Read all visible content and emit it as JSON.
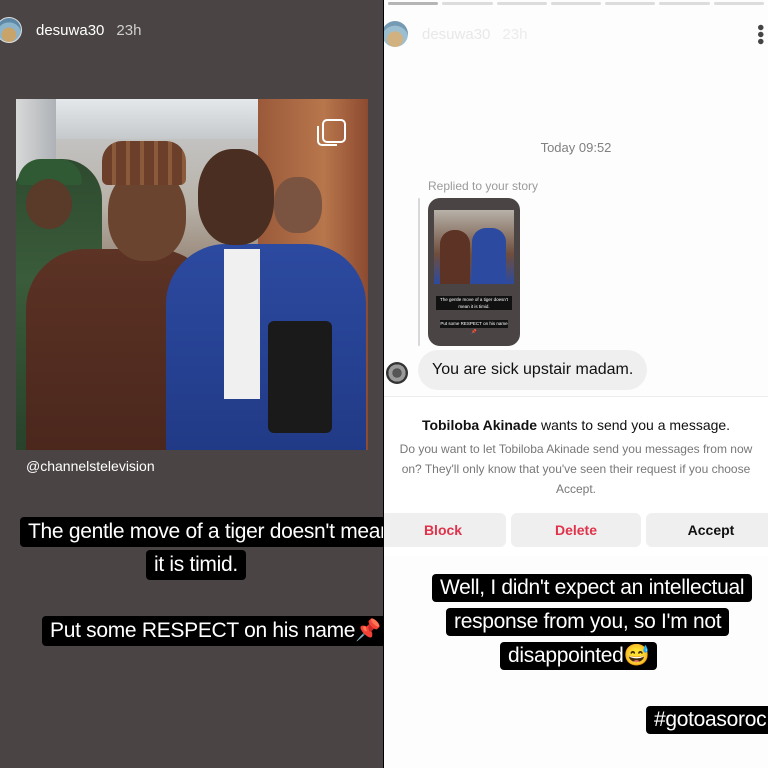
{
  "left_story": {
    "username": "desuwa30",
    "time": "23h",
    "photo_credit": "@channelstelevision",
    "caption_lines": [
      "The gentle move of a tiger doesn't mean",
      "it is timid.",
      "Put some RESPECT on his name📌"
    ]
  },
  "right_story": {
    "username": "desuwa30",
    "time": "23h",
    "chat": {
      "timestamp": "Today 09:52",
      "replied_label": "Replied to your story",
      "thumb_caption_1": "The gentle move of a tiger doesn't mean it is timid.",
      "thumb_caption_2": "Put some RESPECT on his name📌",
      "message": "You are sick upstair madam."
    },
    "request": {
      "sender": "Tobiloba Akinade",
      "title_rest": " wants to send you a message.",
      "subtitle": "Do you want to let Tobiloba Akinade send you messages from now on? They'll only know that you've seen their request if you choose Accept.",
      "block_label": "Block",
      "delete_label": "Delete",
      "accept_label": "Accept"
    },
    "caption_lines": [
      "Well, I didn't expect an intellectual",
      "response from you, so I'm not",
      "disappointed😅"
    ],
    "hashtag": "#gotoasoroc"
  },
  "colors": {
    "left_bg": "#4a4444",
    "caption_bg": "#000000",
    "destructive": "#e0334b"
  }
}
